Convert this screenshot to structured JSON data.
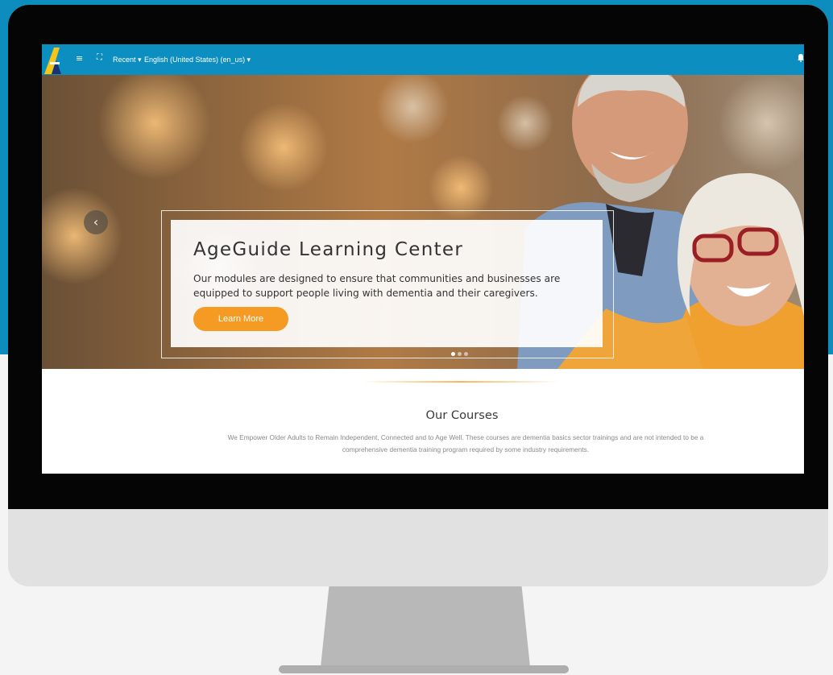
{
  "navbar": {
    "menu_icon": "hamburger-icon",
    "fullscreen_icon": "fullscreen-icon",
    "recent_label": "Recent ▾",
    "language_label": "English (United States) (en_us) ▾",
    "notifications_icon": "bell-icon",
    "brand_colors": {
      "yellow": "#f5c518",
      "navy": "#1b2a6b"
    },
    "bar_color": "#0d8ec0"
  },
  "hero": {
    "prev_icon": "chevron-left-icon",
    "title": "AgeGuide Learning Center",
    "description": "Our modules are designed to ensure that communities and businesses are equipped to support people living with dementia and their caregivers.",
    "button_label": "Learn More",
    "button_color": "#f59a22",
    "slide_count": 3,
    "active_slide": 1
  },
  "courses": {
    "title": "Our Courses",
    "description": "We Empower Older Adults to Remain Independent, Connected and to Age Well. These courses are dementia basics sector trainings and are not intended to be a comprehensive dementia training program required by some industry requirements."
  }
}
